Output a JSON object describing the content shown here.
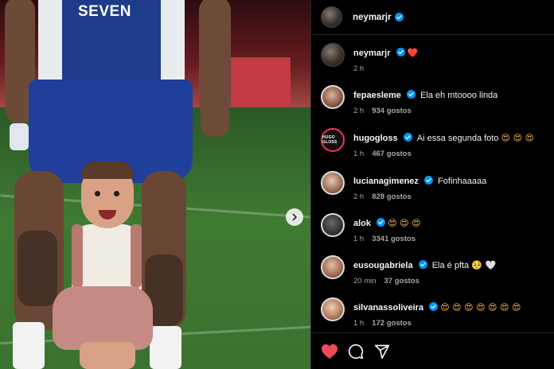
{
  "photo": {
    "sponsor_text": "SEVEN"
  },
  "post_header": {
    "username": "neymarjr"
  },
  "caption": {
    "username": "neymarjr",
    "text": "❤️",
    "time": "2 h"
  },
  "comments": [
    {
      "username": "fepaesleme",
      "text": "Ela eh mtoooo linda",
      "time": "2 h",
      "likes": "934 gostos"
    },
    {
      "username": "hugogloss",
      "text": "Ai essa segunda foto",
      "emoji": "😍 😍 😍",
      "time": "1 h",
      "likes": "467 gostos",
      "avatar_text": "HUGO GLOSS"
    },
    {
      "username": "lucianagimenez",
      "text": "Fofinhaaaaa",
      "time": "2 h",
      "likes": "828 gostos"
    },
    {
      "username": "alok",
      "text": "",
      "emoji": "😍 😍 😍",
      "time": "1 h",
      "likes": "3341 gostos"
    },
    {
      "username": "eusougabriela",
      "text": "Ela é pfta",
      "emoji": "🥺 🤍",
      "time": "20 min",
      "likes": "37 gostos"
    },
    {
      "username": "silvanassoliveira",
      "text": "",
      "emoji": "😍 😍 😍 😍 😍 😍 😍",
      "time": "1 h",
      "likes": "172 gostos"
    }
  ],
  "icons": {
    "like": "heart-icon",
    "comment": "comment-icon",
    "share": "share-icon",
    "next": "chevron-right-icon",
    "verified": "verified-badge-icon"
  },
  "colors": {
    "background": "#000000",
    "verified_blue": "#0095f6",
    "like_red": "#ed4956",
    "meta_gray": "#a8a8a8"
  }
}
